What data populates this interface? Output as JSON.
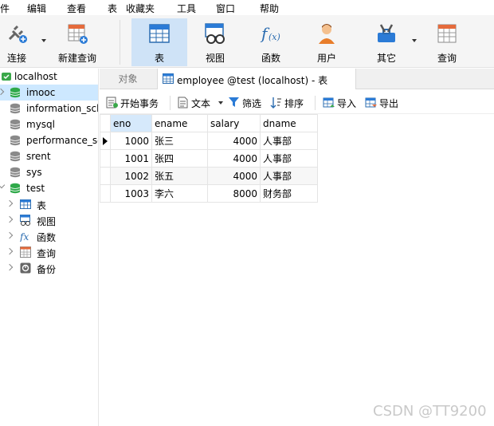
{
  "menu": [
    "件",
    "编辑",
    "查看",
    "表",
    "收藏夹",
    "工具",
    "窗口",
    "帮助"
  ],
  "toolbar": {
    "connect": "连接",
    "new_query": "新建查询",
    "table": "表",
    "view": "视图",
    "function": "函数",
    "user": "用户",
    "other": "其它",
    "query": "查询"
  },
  "tree": {
    "connection": "localhost",
    "databases": [
      "imooc",
      "information_sch",
      "mysql",
      "performance_sc",
      "srent",
      "sys",
      "test"
    ],
    "test_children": [
      "表",
      "视图",
      "函数",
      "查询",
      "备份"
    ]
  },
  "tabs": {
    "objects": "对象",
    "active": "employee @test (localhost) - 表"
  },
  "subtoolbar": {
    "begin_tx": "开始事务",
    "text": "文本",
    "filter": "筛选",
    "sort": "排序",
    "import": "导入",
    "export": "导出"
  },
  "grid": {
    "columns": [
      "eno",
      "ename",
      "salary",
      "dname"
    ],
    "rows": [
      [
        "1000",
        "张三",
        "4000",
        "人事部"
      ],
      [
        "1001",
        "张四",
        "4000",
        "人事部"
      ],
      [
        "1002",
        "张五",
        "4000",
        "人事部"
      ],
      [
        "1003",
        "李六",
        "8000",
        "财务部"
      ]
    ]
  },
  "watermark": "CSDN @TT9200"
}
